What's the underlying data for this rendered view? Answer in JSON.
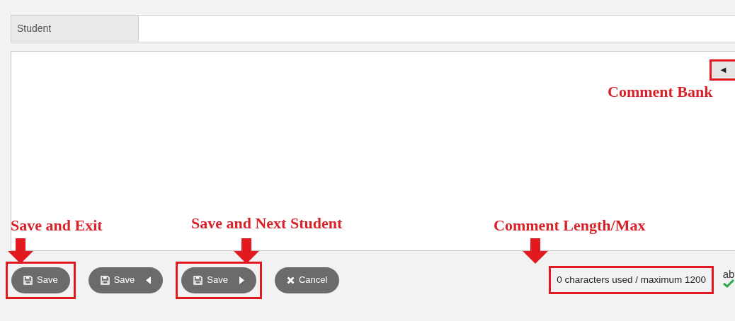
{
  "student_field": {
    "label": "Student"
  },
  "comment_bank_button": {
    "icon": "◄",
    "highlighted": true
  },
  "buttons": [
    {
      "kind": "save",
      "label": "Save",
      "highlighted": true
    },
    {
      "kind": "save_previous",
      "label": "Save",
      "highlighted": false
    },
    {
      "kind": "save_next",
      "label": "Save",
      "highlighted": true
    },
    {
      "kind": "cancel",
      "label": "Cancel",
      "highlighted": false
    }
  ],
  "character_count": {
    "text": "0 characters used / maximum 1200",
    "highlighted": true
  },
  "spell_check": {
    "label": "ab"
  },
  "annotations": [
    {
      "text": "Comment Bank",
      "arrow": false
    },
    {
      "text": "Save and Exit",
      "arrow": true
    },
    {
      "text": "Save and Next Student",
      "arrow": true
    },
    {
      "text": "Comment Length/Max",
      "arrow": true
    }
  ]
}
